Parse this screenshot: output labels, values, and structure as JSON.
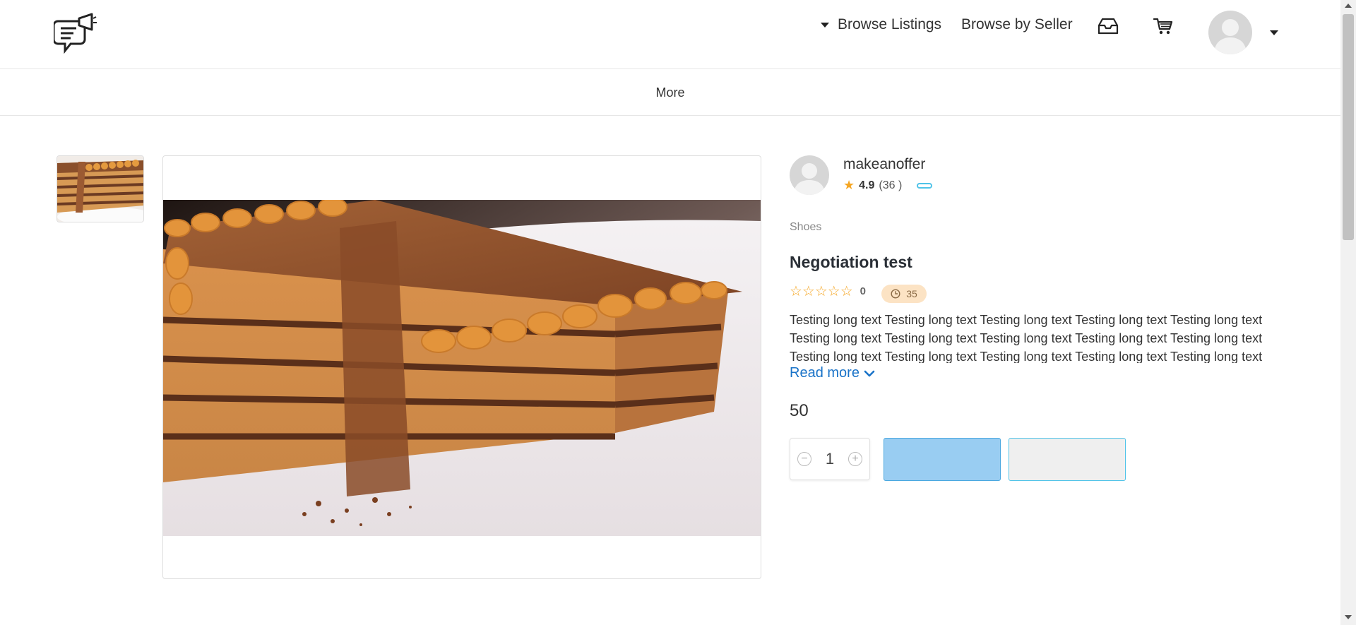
{
  "header": {
    "logo_icon": "megaphone-chat-icon",
    "nav": {
      "browse_listings": "Browse Listings",
      "browse_by_seller": "Browse by Seller"
    },
    "inbox_icon": "inbox-icon",
    "cart_icon": "cart-icon",
    "avatar_icon": "user-avatar-icon"
  },
  "subnav": {
    "more": "More"
  },
  "gallery": {
    "thumbnail_count": 1,
    "image_subject": "layered caramel cake"
  },
  "seller": {
    "name": "makeanoffer",
    "rating": "4.9",
    "reviews": "(36 )",
    "star_color": "#f5a623"
  },
  "product": {
    "category": "Shoes",
    "title": "Negotiation test",
    "stars": "☆☆☆☆☆",
    "review_count": "0",
    "time_badge": "35",
    "description": "Testing long text Testing long text Testing long text Testing long text Testing long text Testing long text Testing long text Testing long text Testing long text Testing long text Testing long text Testing long text Testing long text Testing long text Testing long text Testing long text Testing long text",
    "read_more": "Read more",
    "price": "50"
  },
  "purchase": {
    "quantity": "1",
    "minus_symbol": "−",
    "plus_symbol": "+",
    "primary_color": "#99cdf2",
    "secondary_color": "#efefef"
  }
}
